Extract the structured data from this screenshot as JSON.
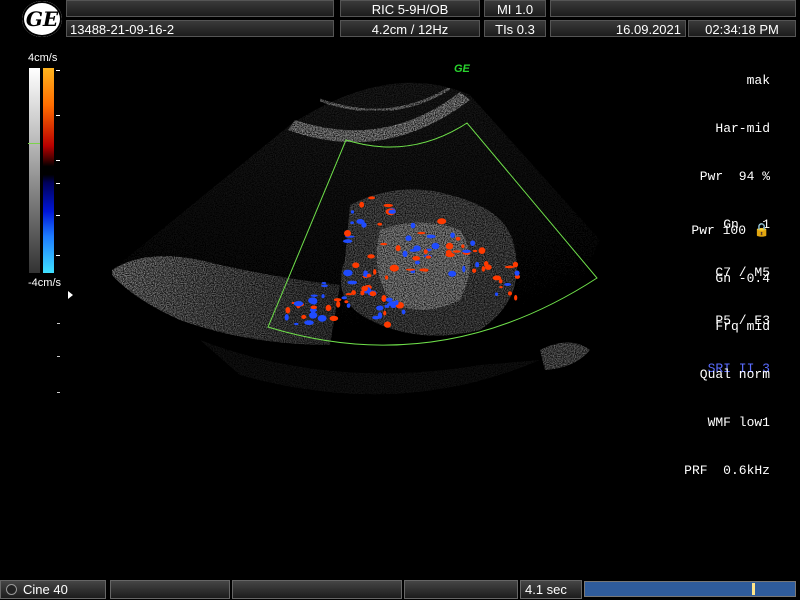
{
  "header": {
    "logo_text": "GE",
    "patient_id": "13488-21-09-16-2",
    "probe": "RIC 5-9H/OB",
    "mi": "MI  1.0",
    "depth_freq": "4.2cm / 12Hz",
    "tis": "TIs  0.3",
    "date": "16.09.2021",
    "time": "02:34:18 PM"
  },
  "image_params": [
    "mak",
    "Har-mid",
    "Pwr  94 %",
    "Gn   1",
    "C7 / M5",
    "P5 / E3"
  ],
  "sri": "SRI II 3",
  "color_params": [
    "Pwr 100 🔒",
    "Gn -0.4",
    "Frq mid",
    "Qual norm",
    "WMF low1",
    "PRF  0.6kHz"
  ],
  "scale": {
    "top": "4cm/s",
    "bottom": "-4cm/s"
  },
  "ge_watermark": "GE",
  "footer": {
    "cine_label": "Cine 40",
    "duration": "4.1 sec",
    "cine_position": 0.81
  },
  "colors": {
    "doppler_red": "#ff3a00",
    "doppler_blue": "#1f4bff",
    "roi_box": "#6fe04a"
  }
}
